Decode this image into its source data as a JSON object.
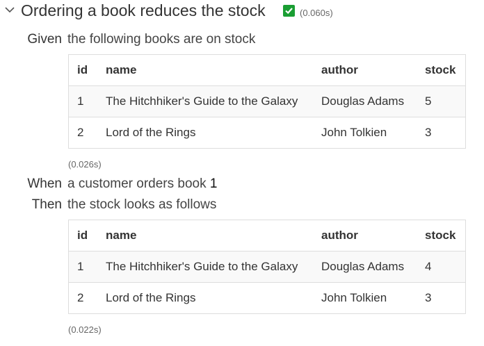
{
  "scenario": {
    "title": "Ordering a book reduces the stock",
    "duration": "(0.060s)"
  },
  "steps": [
    {
      "keyword": "Given",
      "text": "the following books are on stock",
      "table": {
        "headers": [
          "id",
          "name",
          "author",
          "stock"
        ],
        "rows": [
          [
            "1",
            "The Hitchhiker's Guide to the Galaxy",
            "Douglas Adams",
            "5"
          ],
          [
            "2",
            "Lord of the Rings",
            "John Tolkien",
            "3"
          ]
        ]
      },
      "duration": "(0.026s)"
    },
    {
      "keyword": "When",
      "text": "a customer orders book",
      "argument": "1"
    },
    {
      "keyword": "Then",
      "text": "the stock looks as follows",
      "table": {
        "headers": [
          "id",
          "name",
          "author",
          "stock"
        ],
        "rows": [
          [
            "1",
            "The Hitchhiker's Guide to the Galaxy",
            "Douglas Adams",
            "4"
          ],
          [
            "2",
            "Lord of the Rings",
            "John Tolkien",
            "3"
          ]
        ]
      },
      "duration": "(0.022s)"
    }
  ],
  "icons": {
    "toggle": "chevron-down-icon",
    "status": "checkmark-icon"
  },
  "colors": {
    "success": "#1a9e33"
  }
}
